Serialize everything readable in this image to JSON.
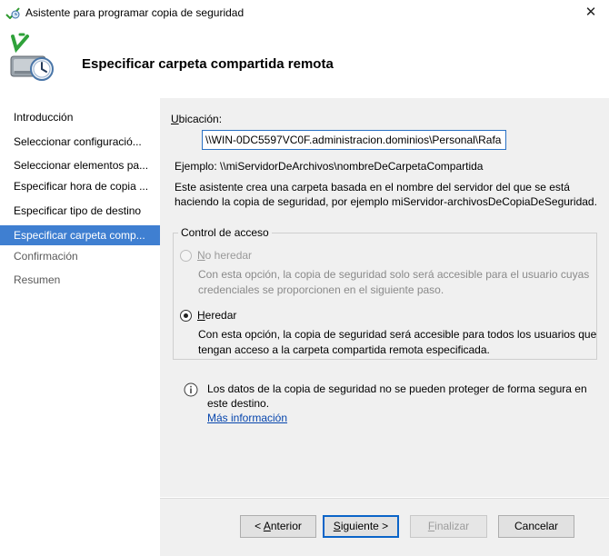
{
  "window": {
    "title": "Asistente para programar copia de seguridad",
    "close_glyph": "✕"
  },
  "header": {
    "title": "Especificar carpeta compartida remota",
    "icon": "backup-schedule-icon"
  },
  "sidebar": {
    "items": [
      {
        "label": "Introducción",
        "state": "normal"
      },
      {
        "label": "Seleccionar configuració...",
        "state": "normal"
      },
      {
        "label": "Seleccionar elementos pa...",
        "state": "normal"
      },
      {
        "label": "Especificar hora de copia ...",
        "state": "normal"
      },
      {
        "label": "Especificar tipo de destino",
        "state": "normal"
      },
      {
        "label": "Especificar carpeta comp...",
        "state": "selected"
      },
      {
        "label": "Confirmación",
        "state": "disabled"
      },
      {
        "label": "Resumen",
        "state": "disabled"
      }
    ]
  },
  "main": {
    "location_label_accel": "U",
    "location_label_rest": "bicación:",
    "location_value": "\\\\WIN-0DC5597VC0F.administracion.dominios\\Personal\\Rafa",
    "example": "Ejemplo: \\\\miServidorDeArchivos\\nombreDeCarpetaCompartida",
    "description": "Este asistente crea una carpeta basada en el nombre del servidor del que se está haciendo la copia de seguridad, por ejemplo miServidor-archivosDeCopiaDeSeguridad."
  },
  "access_control": {
    "title": "Control de acceso",
    "no_inherit": {
      "label_accel": "N",
      "label_rest": "o heredar",
      "selected": false,
      "enabled": false,
      "description": "Con esta opción, la copia de seguridad solo será accesible para el usuario cuyas credenciales se proporcionen en el siguiente paso."
    },
    "inherit": {
      "label_accel": "H",
      "label_rest": "eredar",
      "selected": true,
      "enabled": true,
      "description": "Con esta opción, la copia de seguridad será accesible para todos los usuarios que tengan acceso a la carpeta compartida remota especificada."
    }
  },
  "info": {
    "icon": "info-icon",
    "text": "Los datos de la copia de seguridad no se pueden proteger de forma segura en este destino.",
    "link": "Más información"
  },
  "buttons": {
    "back_prefix": "< ",
    "back_accel": "A",
    "back_rest": "nterior",
    "next_accel": "S",
    "next_rest": "iguiente >",
    "finish_accel": "F",
    "finish_rest": "inalizar",
    "cancel": "Cancelar"
  },
  "colors": {
    "selection": "#3f7fd1",
    "link": "#0645ad",
    "focus_border": "#0a64c8"
  }
}
